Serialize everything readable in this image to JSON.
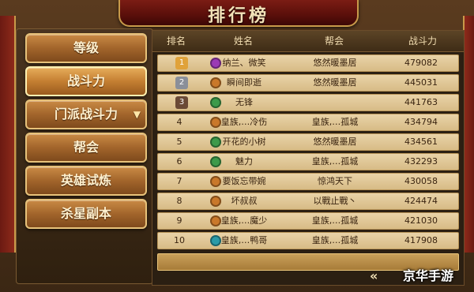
{
  "title": "排行榜",
  "tabs": [
    {
      "label": "等级",
      "active": false
    },
    {
      "label": "战斗力",
      "active": true
    },
    {
      "label": "门派战斗力",
      "active": false,
      "caret": "▼"
    },
    {
      "label": "帮会",
      "active": false
    },
    {
      "label": "英雄试炼",
      "active": false
    },
    {
      "label": "杀星副本",
      "active": false
    }
  ],
  "table": {
    "headers": [
      "排名",
      "姓名",
      "帮会",
      "战斗力"
    ],
    "rows": [
      {
        "rank": "1",
        "icon": "purple-gem-icon",
        "name": "纳兰、微笑",
        "guild": "悠然暖墨居",
        "power": "479082"
      },
      {
        "rank": "2",
        "icon": "orange-sword-icon",
        "name": "瞬间即逝",
        "guild": "悠然暖墨居",
        "power": "445031"
      },
      {
        "rank": "3",
        "icon": "green-leaf-icon",
        "name": "无锋",
        "guild": "",
        "power": "441763"
      },
      {
        "rank": "4",
        "icon": "orange-sword-icon",
        "name": "皇族,…冷伤",
        "guild": "皇族,…孤城",
        "power": "434794"
      },
      {
        "rank": "5",
        "icon": "green-leaf-icon",
        "name": "开花的小树",
        "guild": "悠然暖墨居",
        "power": "434561"
      },
      {
        "rank": "6",
        "icon": "green-leaf-icon",
        "name": "魅力",
        "guild": "皇族,…孤城",
        "power": "432293"
      },
      {
        "rank": "7",
        "icon": "orange-sword-icon",
        "name": "要饭忘带婉",
        "guild": "惊鸿天下",
        "power": "430058"
      },
      {
        "rank": "8",
        "icon": "orange-sword-icon",
        "name": "坏叔叔",
        "guild": "以戰止戰丶",
        "power": "424474"
      },
      {
        "rank": "9",
        "icon": "orange-sword-icon",
        "name": "皇族,…魔少",
        "guild": "皇族,…孤城",
        "power": "421030"
      },
      {
        "rank": "10",
        "icon": "teal-orb-icon",
        "name": "皇族,…鸭哥",
        "guild": "皇族,…孤城",
        "power": "417908"
      }
    ]
  },
  "nav": {
    "back_arrow": "«"
  },
  "watermark": "京华手游",
  "colors": {
    "gold_rank": "#e0a23a",
    "silver_rank": "#8a8f99",
    "bronze_rank": "#6b4a36",
    "purple": "#9b3ab5",
    "orange": "#c9782a",
    "green": "#3d9a4a",
    "teal": "#2a9ba8"
  }
}
